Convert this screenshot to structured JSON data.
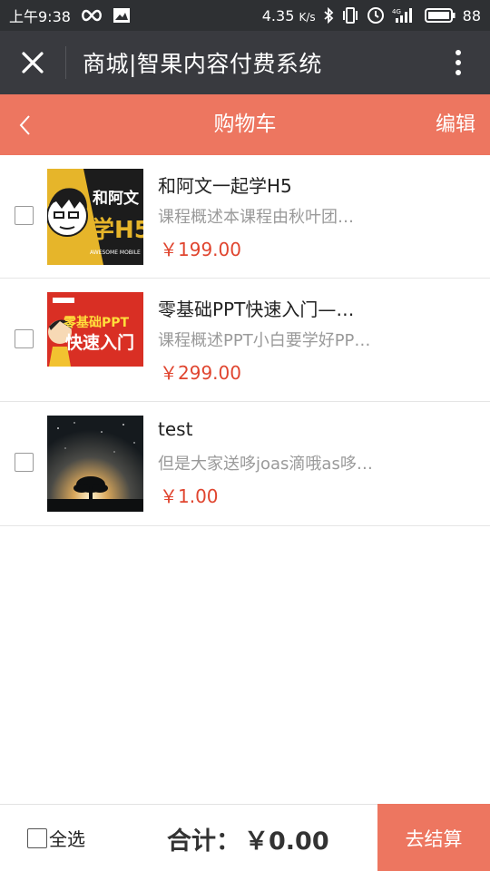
{
  "status_bar": {
    "time": "上午9:38",
    "speed": "4.35",
    "speed_unit": "K/s",
    "battery": "88"
  },
  "app_bar": {
    "title": "商城|智果内容付费系统"
  },
  "cart_header": {
    "title": "购物车",
    "edit_label": "编辑"
  },
  "items": [
    {
      "title": "和阿文一起学H5",
      "description": "课程概述本课程由秋叶团…",
      "price": "￥199.00",
      "thumb_text_top": "和阿文",
      "thumb_text_bottom": "学H5",
      "thumb_caption": "AWESOME MOBILE"
    },
    {
      "title": "零基础PPT快速入门—…",
      "description": "课程概述PPT小白要学好PP…",
      "price": "￥299.00",
      "thumb_text_top": "零基础PPT",
      "thumb_text_bottom": "快速入门"
    },
    {
      "title": "test",
      "description": "但是大家送哆joas滴哦as哆…",
      "price": "￥1.00"
    }
  ],
  "bottom_bar": {
    "select_all_label": "全选",
    "total_label": "合计：",
    "total_amount": "￥0.00",
    "checkout_label": "去结算"
  },
  "colors": {
    "accent": "#ed7660",
    "price": "#e0452f",
    "app_bar": "#393a3f",
    "status_bar": "#2e3033"
  },
  "icons": {
    "app_close": "close-icon",
    "app_more": "more-vertical-icon",
    "cart_back": "chevron-left-icon"
  }
}
